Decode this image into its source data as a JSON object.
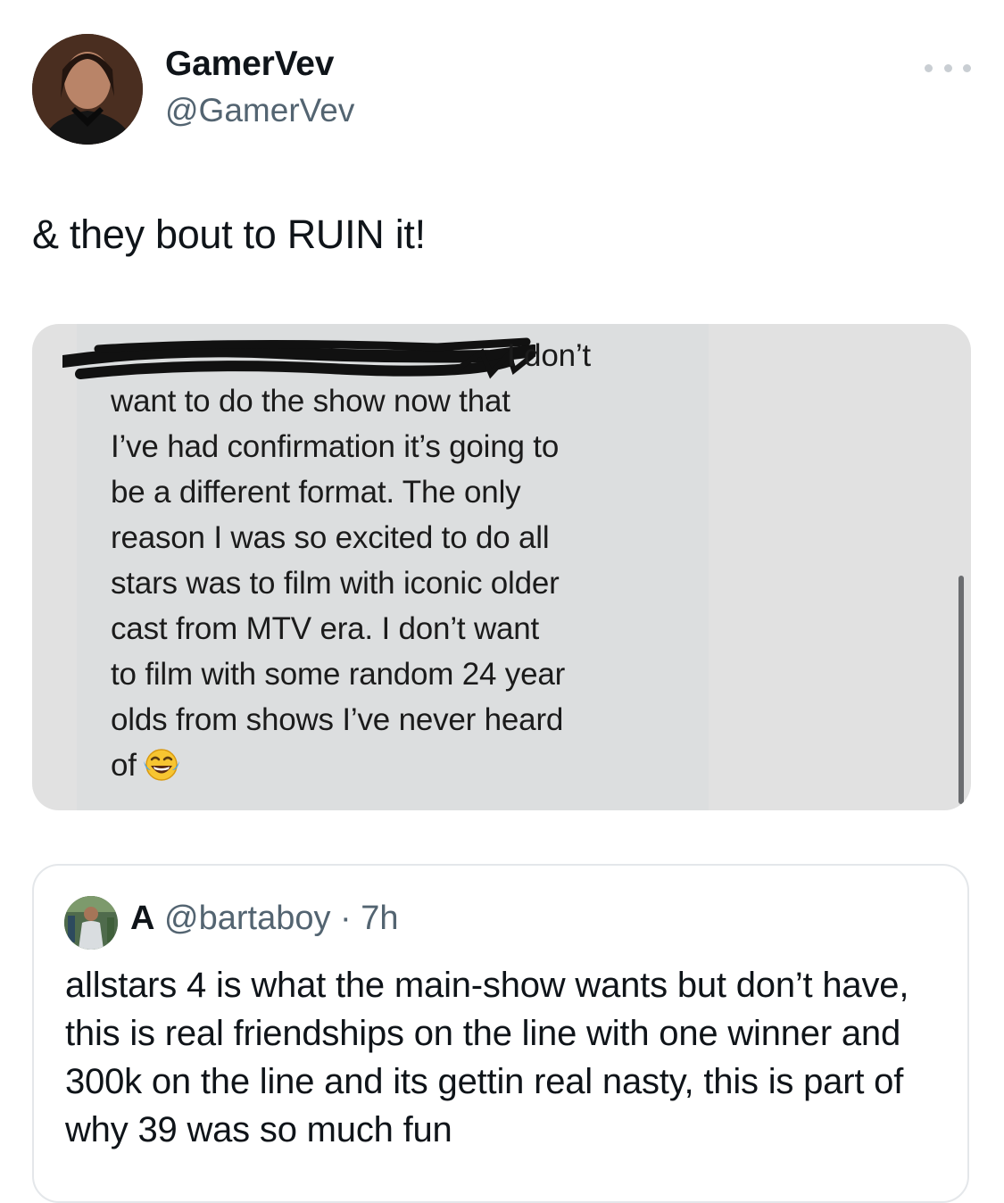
{
  "author": {
    "display_name": "GamerVev",
    "handle": "@GamerVev"
  },
  "tweet": {
    "text": "& they bout to RUIN it!"
  },
  "media": {
    "message_lines": [
      "I don’t",
      "want to do the show now that",
      "I’ve had confirmation it’s going to",
      "be a different format. The only",
      "reason I was so excited to do all",
      "stars was to film with iconic older",
      "cast from MTV era. I don’t want",
      "to film with some random 24 year",
      "olds from shows I’ve never heard",
      "of"
    ],
    "emoji_icon": "face-with-tears-of-joy-icon"
  },
  "quote": {
    "name": "A",
    "handle": "@bartaboy",
    "separator": "·",
    "time": "7h",
    "text": "allstars 4 is what the main-show wants but don’t have, this is real friendships on the line with one winner and 300k on the line and its gettin real nasty, this is part of why 39 was so much fun"
  },
  "icons": {
    "more": "more-options-icon"
  }
}
